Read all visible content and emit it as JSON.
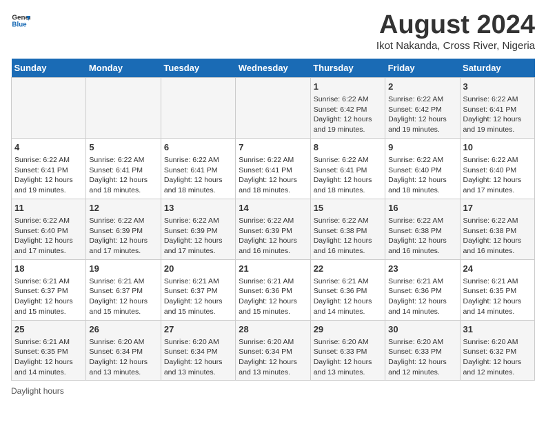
{
  "header": {
    "logo_line1": "General",
    "logo_line2": "Blue",
    "title": "August 2024",
    "subtitle": "Ikot Nakanda, Cross River, Nigeria"
  },
  "days_of_week": [
    "Sunday",
    "Monday",
    "Tuesday",
    "Wednesday",
    "Thursday",
    "Friday",
    "Saturday"
  ],
  "weeks": [
    [
      {
        "day": "",
        "info": ""
      },
      {
        "day": "",
        "info": ""
      },
      {
        "day": "",
        "info": ""
      },
      {
        "day": "",
        "info": ""
      },
      {
        "day": "1",
        "info": "Sunrise: 6:22 AM\nSunset: 6:42 PM\nDaylight: 12 hours and 19 minutes."
      },
      {
        "day": "2",
        "info": "Sunrise: 6:22 AM\nSunset: 6:42 PM\nDaylight: 12 hours and 19 minutes."
      },
      {
        "day": "3",
        "info": "Sunrise: 6:22 AM\nSunset: 6:41 PM\nDaylight: 12 hours and 19 minutes."
      }
    ],
    [
      {
        "day": "4",
        "info": "Sunrise: 6:22 AM\nSunset: 6:41 PM\nDaylight: 12 hours and 19 minutes."
      },
      {
        "day": "5",
        "info": "Sunrise: 6:22 AM\nSunset: 6:41 PM\nDaylight: 12 hours and 18 minutes."
      },
      {
        "day": "6",
        "info": "Sunrise: 6:22 AM\nSunset: 6:41 PM\nDaylight: 12 hours and 18 minutes."
      },
      {
        "day": "7",
        "info": "Sunrise: 6:22 AM\nSunset: 6:41 PM\nDaylight: 12 hours and 18 minutes."
      },
      {
        "day": "8",
        "info": "Sunrise: 6:22 AM\nSunset: 6:41 PM\nDaylight: 12 hours and 18 minutes."
      },
      {
        "day": "9",
        "info": "Sunrise: 6:22 AM\nSunset: 6:40 PM\nDaylight: 12 hours and 18 minutes."
      },
      {
        "day": "10",
        "info": "Sunrise: 6:22 AM\nSunset: 6:40 PM\nDaylight: 12 hours and 17 minutes."
      }
    ],
    [
      {
        "day": "11",
        "info": "Sunrise: 6:22 AM\nSunset: 6:40 PM\nDaylight: 12 hours and 17 minutes."
      },
      {
        "day": "12",
        "info": "Sunrise: 6:22 AM\nSunset: 6:39 PM\nDaylight: 12 hours and 17 minutes."
      },
      {
        "day": "13",
        "info": "Sunrise: 6:22 AM\nSunset: 6:39 PM\nDaylight: 12 hours and 17 minutes."
      },
      {
        "day": "14",
        "info": "Sunrise: 6:22 AM\nSunset: 6:39 PM\nDaylight: 12 hours and 16 minutes."
      },
      {
        "day": "15",
        "info": "Sunrise: 6:22 AM\nSunset: 6:38 PM\nDaylight: 12 hours and 16 minutes."
      },
      {
        "day": "16",
        "info": "Sunrise: 6:22 AM\nSunset: 6:38 PM\nDaylight: 12 hours and 16 minutes."
      },
      {
        "day": "17",
        "info": "Sunrise: 6:22 AM\nSunset: 6:38 PM\nDaylight: 12 hours and 16 minutes."
      }
    ],
    [
      {
        "day": "18",
        "info": "Sunrise: 6:21 AM\nSunset: 6:37 PM\nDaylight: 12 hours and 15 minutes."
      },
      {
        "day": "19",
        "info": "Sunrise: 6:21 AM\nSunset: 6:37 PM\nDaylight: 12 hours and 15 minutes."
      },
      {
        "day": "20",
        "info": "Sunrise: 6:21 AM\nSunset: 6:37 PM\nDaylight: 12 hours and 15 minutes."
      },
      {
        "day": "21",
        "info": "Sunrise: 6:21 AM\nSunset: 6:36 PM\nDaylight: 12 hours and 15 minutes."
      },
      {
        "day": "22",
        "info": "Sunrise: 6:21 AM\nSunset: 6:36 PM\nDaylight: 12 hours and 14 minutes."
      },
      {
        "day": "23",
        "info": "Sunrise: 6:21 AM\nSunset: 6:36 PM\nDaylight: 12 hours and 14 minutes."
      },
      {
        "day": "24",
        "info": "Sunrise: 6:21 AM\nSunset: 6:35 PM\nDaylight: 12 hours and 14 minutes."
      }
    ],
    [
      {
        "day": "25",
        "info": "Sunrise: 6:21 AM\nSunset: 6:35 PM\nDaylight: 12 hours and 14 minutes."
      },
      {
        "day": "26",
        "info": "Sunrise: 6:20 AM\nSunset: 6:34 PM\nDaylight: 12 hours and 13 minutes."
      },
      {
        "day": "27",
        "info": "Sunrise: 6:20 AM\nSunset: 6:34 PM\nDaylight: 12 hours and 13 minutes."
      },
      {
        "day": "28",
        "info": "Sunrise: 6:20 AM\nSunset: 6:34 PM\nDaylight: 12 hours and 13 minutes."
      },
      {
        "day": "29",
        "info": "Sunrise: 6:20 AM\nSunset: 6:33 PM\nDaylight: 12 hours and 13 minutes."
      },
      {
        "day": "30",
        "info": "Sunrise: 6:20 AM\nSunset: 6:33 PM\nDaylight: 12 hours and 12 minutes."
      },
      {
        "day": "31",
        "info": "Sunrise: 6:20 AM\nSunset: 6:32 PM\nDaylight: 12 hours and 12 minutes."
      }
    ]
  ],
  "footer": {
    "daylight_label": "Daylight hours"
  }
}
